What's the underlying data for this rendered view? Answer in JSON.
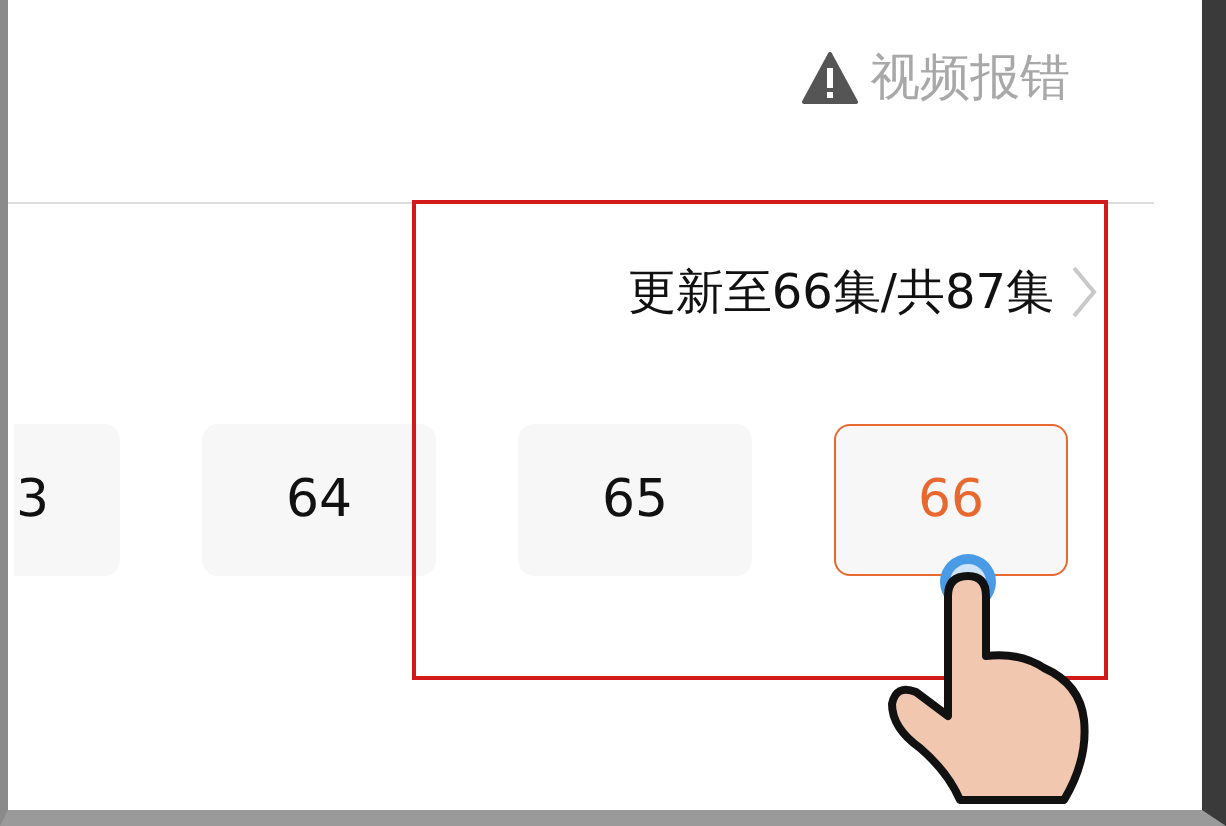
{
  "report": {
    "label": "视频报错"
  },
  "episodes_header": {
    "label": "更新至66集/共87集"
  },
  "episodes": [
    {
      "label": "3",
      "selected": false,
      "partial": true
    },
    {
      "label": "64",
      "selected": false
    },
    {
      "label": "65",
      "selected": false
    },
    {
      "label": "66",
      "selected": true
    }
  ]
}
